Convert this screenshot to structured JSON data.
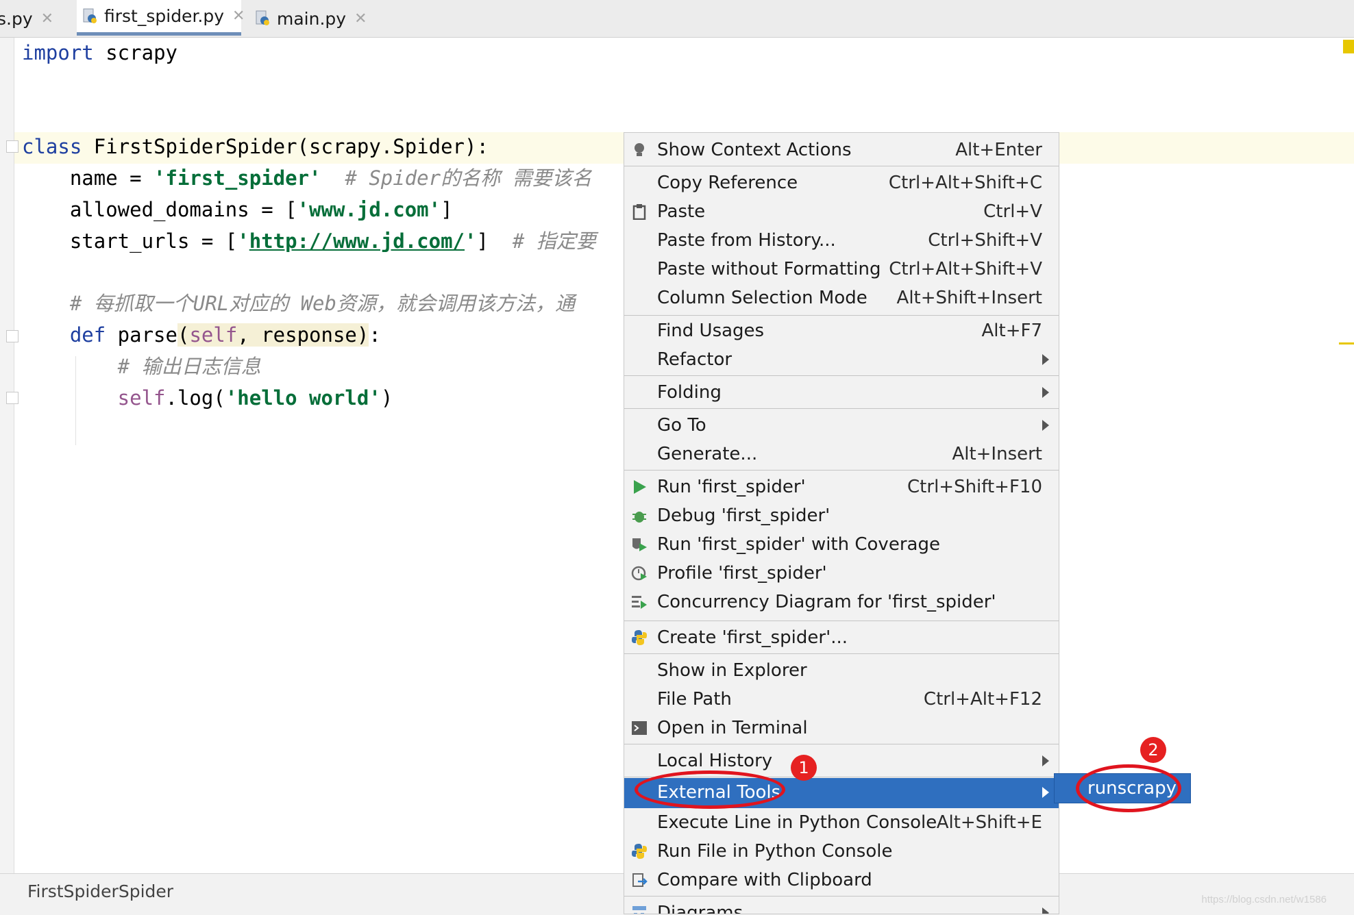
{
  "tabs": [
    {
      "label": "s.py"
    },
    {
      "label": "first_spider.py"
    },
    {
      "label": "main.py"
    }
  ],
  "code": {
    "l1_kw": "import",
    "l1_rest": " scrapy",
    "l2_kw": "class",
    "l2_rest": " FirstSpiderSpider(scrapy.Spider):",
    "l3_a": "    name = ",
    "l3_str": "'first_spider'",
    "l3_cmt": "  # Spider的名称 需要该名",
    "l4_a": "    allowed_domains = [",
    "l4_str": "'www.jd.com'",
    "l4_b": "]",
    "l5_a": "    start_urls = [",
    "l5_q1": "'",
    "l5_link": "http://www.jd.com/",
    "l5_q2": "'",
    "l5_b": "]  ",
    "l5_cmt": "# 指定要",
    "l6_cmt": "    # 每抓取一个URL对应的 Web资源，就会调用该方法，通",
    "l7_kw": "    def",
    "l7_a": " parse",
    "l7_p1": "(",
    "l7_self": "self",
    "l7_p2": ", response)",
    "l7_b": ":",
    "l8_cmt": "        # 输出日志信息",
    "l9_self": "        self",
    "l9_a": ".log(",
    "l9_str": "'hello world'",
    "l9_b": ")"
  },
  "status": {
    "breadcrumb": "FirstSpiderSpider",
    "watermark": "https://blog.csdn.net/w1586"
  },
  "menu": {
    "show_context_actions": {
      "label": "Show Context Actions",
      "shortcut": "Alt+Enter"
    },
    "copy_reference": {
      "label": "Copy Reference",
      "shortcut": "Ctrl+Alt+Shift+C"
    },
    "paste": {
      "label": "Paste",
      "shortcut": "Ctrl+V"
    },
    "paste_history": {
      "label": "Paste from History...",
      "shortcut": "Ctrl+Shift+V"
    },
    "paste_no_format": {
      "label": "Paste without Formatting",
      "shortcut": "Ctrl+Alt+Shift+V"
    },
    "column_selection": {
      "label": "Column Selection Mode",
      "shortcut": "Alt+Shift+Insert"
    },
    "find_usages": {
      "label": "Find Usages",
      "shortcut": "Alt+F7"
    },
    "refactor": {
      "label": "Refactor"
    },
    "folding": {
      "label": "Folding"
    },
    "go_to": {
      "label": "Go To"
    },
    "generate": {
      "label": "Generate...",
      "shortcut": "Alt+Insert"
    },
    "run": {
      "label": "Run 'first_spider'",
      "shortcut": "Ctrl+Shift+F10"
    },
    "debug": {
      "label": "Debug 'first_spider'"
    },
    "run_coverage": {
      "label": "Run 'first_spider' with Coverage"
    },
    "profile": {
      "label": "Profile 'first_spider'"
    },
    "concurrency": {
      "label": "Concurrency Diagram for 'first_spider'"
    },
    "create": {
      "label": "Create 'first_spider'..."
    },
    "show_explorer": {
      "label": "Show in Explorer"
    },
    "file_path": {
      "label": "File Path",
      "shortcut": "Ctrl+Alt+F12"
    },
    "open_terminal": {
      "label": "Open in Terminal"
    },
    "local_history": {
      "label": "Local History"
    },
    "external_tools": {
      "label": "External Tools"
    },
    "execute_line": {
      "label": "Execute Line in Python Console",
      "shortcut": "Alt+Shift+E"
    },
    "run_file_console": {
      "label": "Run File in Python Console"
    },
    "compare_clipboard": {
      "label": "Compare with Clipboard"
    },
    "diagrams": {
      "label": "Diagrams"
    }
  },
  "submenu": {
    "item": "runscrapy"
  },
  "annotations": {
    "badge1": "1",
    "badge2": "2"
  },
  "colors": {
    "accent": "#2f6fbf",
    "annotation": "#e0141e"
  }
}
